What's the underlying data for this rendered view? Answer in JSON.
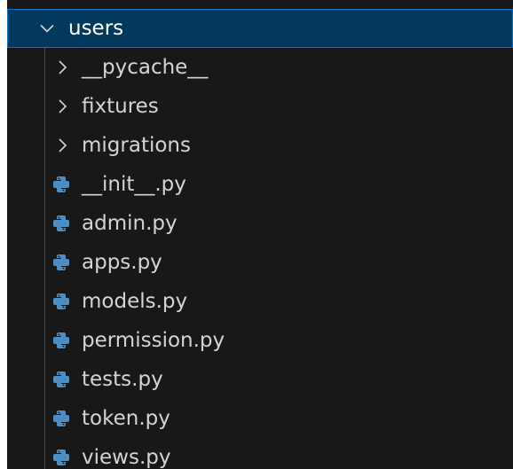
{
  "root_folder": {
    "label": "users",
    "expanded": true,
    "icon": "chevron-down-icon"
  },
  "folders": [
    {
      "label": "__pycache__",
      "icon": "chevron-right-icon",
      "expanded": false
    },
    {
      "label": "fixtures",
      "icon": "chevron-right-icon",
      "expanded": false
    },
    {
      "label": "migrations",
      "icon": "chevron-right-icon",
      "expanded": false
    }
  ],
  "files": [
    {
      "label": "__init__.py",
      "icon": "python-file-icon"
    },
    {
      "label": "admin.py",
      "icon": "python-file-icon"
    },
    {
      "label": "apps.py",
      "icon": "python-file-icon"
    },
    {
      "label": "models.py",
      "icon": "python-file-icon"
    },
    {
      "label": "permission.py",
      "icon": "python-file-icon"
    },
    {
      "label": "tests.py",
      "icon": "python-file-icon"
    },
    {
      "label": "token.py",
      "icon": "python-file-icon"
    },
    {
      "label": "views.py",
      "icon": "python-file-icon"
    }
  ],
  "colors": {
    "background": "#181818",
    "selection": "#04395e",
    "selection_border": "#0078d4",
    "text": "#d4d4d4",
    "python_icon": "#4d8fc4"
  }
}
